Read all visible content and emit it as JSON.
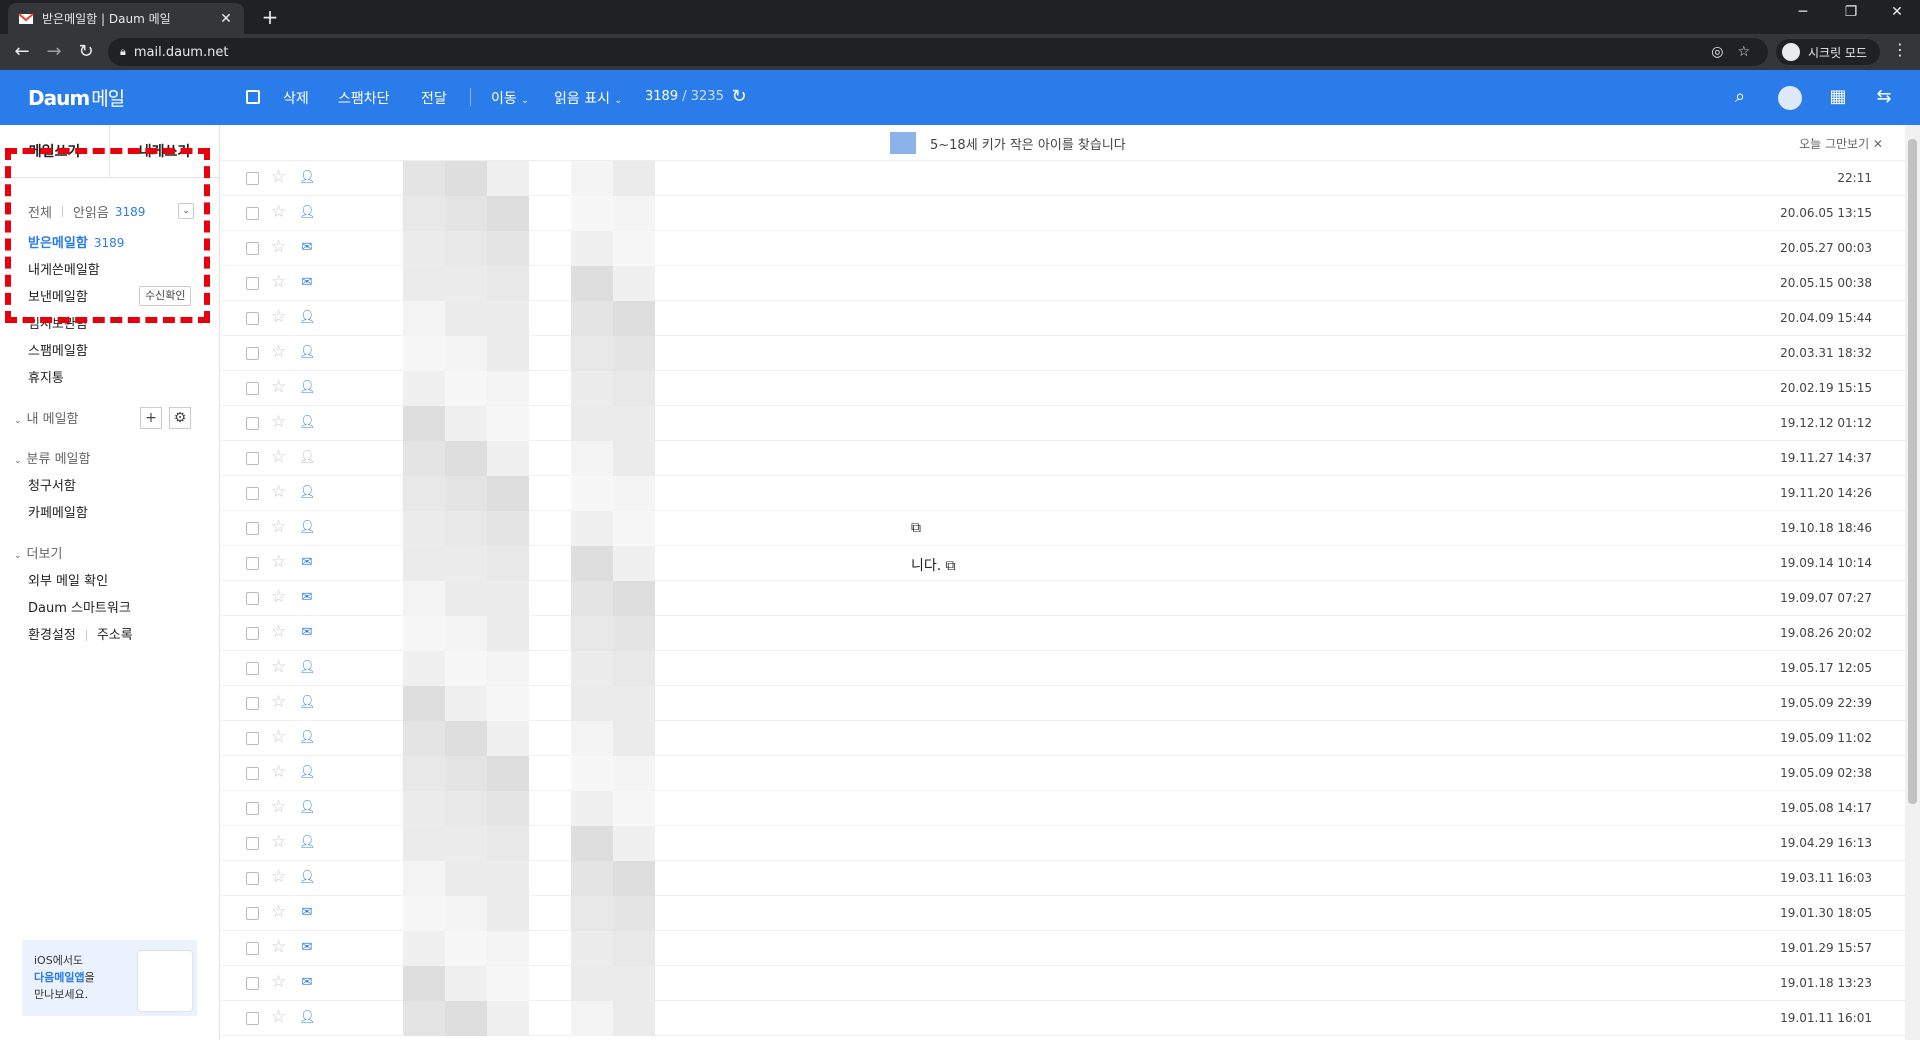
{
  "browser": {
    "tab_title": "받은메일함 | Daum 메일",
    "url": "mail.daum.net",
    "incognito_label": "시크릿 모드"
  },
  "header": {
    "logo": "Daum",
    "logo_sub": "메일",
    "delete": "삭제",
    "spam_block": "스팸차단",
    "forward": "전달",
    "move": "이동",
    "mark_read": "읽음 표시",
    "selected_count": "3189",
    "count_sep": "/",
    "total_count": "3235"
  },
  "sidebar": {
    "compose": "메일쓰기",
    "compose_self": "내게쓰기",
    "filter_all": "전체",
    "filter_unread": "안읽음",
    "unread_count": "3189",
    "mailboxes": [
      {
        "label": "받은메일함",
        "count": "3189"
      },
      {
        "label": "내게쓴메일함",
        "count": ""
      },
      {
        "label": "보낸메일함",
        "count": ""
      },
      {
        "label": "임시보관함",
        "count": ""
      },
      {
        "label": "스팸메일함",
        "count": ""
      },
      {
        "label": "휴지통",
        "count": ""
      }
    ],
    "receipt_check": "수신확인",
    "my_mailbox": "내 메일함",
    "category_mailbox": "분류 메일함",
    "categories": [
      "청구서함",
      "카페메일함"
    ],
    "more": "더보기",
    "more_items": [
      "외부 메일 확인",
      "Daum 스마트워크",
      "환경설정",
      "주소록"
    ],
    "promo": {
      "line1": "iOS에서도",
      "line2": "다음메일앱",
      "line2b": "을",
      "line3": "만나보세요."
    }
  },
  "notice": {
    "text": "5~18세 키가 작은 아이를 찾습니다",
    "close": "오늘 그만보기 ✕"
  },
  "mails": [
    {
      "date": "22:11",
      "icon": "person",
      "subject": ""
    },
    {
      "date": "20.06.05 13:15",
      "icon": "person",
      "subject": ""
    },
    {
      "date": "20.05.27 00:03",
      "icon": "mail",
      "subject": ""
    },
    {
      "date": "20.05.15 00:38",
      "icon": "mail",
      "subject": ""
    },
    {
      "date": "20.04.09 15:44",
      "icon": "person",
      "subject": ""
    },
    {
      "date": "20.03.31 18:32",
      "icon": "person",
      "subject": ""
    },
    {
      "date": "20.02.19 15:15",
      "icon": "person",
      "subject": ""
    },
    {
      "date": "19.12.12 01:12",
      "icon": "person",
      "subject": ""
    },
    {
      "date": "19.11.27 14:37",
      "icon": "person-gray",
      "subject": ""
    },
    {
      "date": "19.11.20 14:26",
      "icon": "person",
      "subject": ""
    },
    {
      "date": "19.10.18 18:46",
      "icon": "person",
      "subject": "⧉"
    },
    {
      "date": "19.09.14 10:14",
      "icon": "mail",
      "subject": "니다. ⧉"
    },
    {
      "date": "19.09.07 07:27",
      "icon": "mail",
      "subject": ""
    },
    {
      "date": "19.08.26 20:02",
      "icon": "mail",
      "subject": ""
    },
    {
      "date": "19.05.17 12:05",
      "icon": "person",
      "subject": ""
    },
    {
      "date": "19.05.09 22:39",
      "icon": "person",
      "subject": ""
    },
    {
      "date": "19.05.09 11:02",
      "icon": "person",
      "subject": ""
    },
    {
      "date": "19.05.09 02:38",
      "icon": "person",
      "subject": ""
    },
    {
      "date": "19.05.08 14:17",
      "icon": "person",
      "subject": ""
    },
    {
      "date": "19.04.29 16:13",
      "icon": "person",
      "subject": ""
    },
    {
      "date": "19.03.11 16:03",
      "icon": "person",
      "subject": ""
    },
    {
      "date": "19.01.30 18:05",
      "icon": "mail",
      "subject": ""
    },
    {
      "date": "19.01.29 15:57",
      "icon": "mail",
      "subject": ""
    },
    {
      "date": "19.01.18 13:23",
      "icon": "mail",
      "subject": ""
    },
    {
      "date": "19.01.11 16:01",
      "icon": "person",
      "subject": ""
    }
  ],
  "colors": {
    "accent": "#2b7ceb",
    "highlight_box": "#e8000d"
  }
}
